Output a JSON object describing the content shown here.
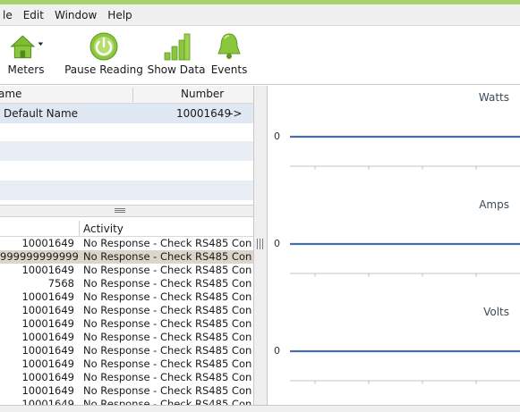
{
  "menu": {
    "items": [
      "le",
      "Edit",
      "Window",
      "Help"
    ]
  },
  "toolbar": {
    "meters_label": "Meters",
    "pause_label": "Pause Reading",
    "show_data_label": "Show Data",
    "events_label": "Events"
  },
  "meters_table": {
    "headers": {
      "name": "ame",
      "number": "Number"
    },
    "rows": [
      {
        "name": "Default Name",
        "number": "10001649",
        "arrow": "->"
      }
    ]
  },
  "activity_table": {
    "headers": {
      "activity": "Activity"
    },
    "rows": [
      {
        "id": "10001649",
        "activity": "No Response - Check RS485 Conn..."
      },
      {
        "id": "999999999999",
        "activity": "No Response - Check RS485 Conn..."
      },
      {
        "id": "10001649",
        "activity": "No Response - Check RS485 Conn..."
      },
      {
        "id": "7568",
        "activity": "No Response - Check RS485 Conn..."
      },
      {
        "id": "10001649",
        "activity": "No Response - Check RS485 Conn..."
      },
      {
        "id": "10001649",
        "activity": "No Response - Check RS485 Conn..."
      },
      {
        "id": "10001649",
        "activity": "No Response - Check RS485 Conn..."
      },
      {
        "id": "10001649",
        "activity": "No Response - Check RS485 Conn..."
      },
      {
        "id": "10001649",
        "activity": "No Response - Check RS485 Conn..."
      },
      {
        "id": "10001649",
        "activity": "No Response - Check RS485 Conn..."
      },
      {
        "id": "10001649",
        "activity": "No Response - Check RS485 Conn..."
      },
      {
        "id": "10001649",
        "activity": "No Response - Check RS485 Conn..."
      },
      {
        "id": "10001649",
        "activity": "No Response - Check RS485 Conn..."
      }
    ]
  },
  "charts": [
    {
      "title": "Watts",
      "y_value_label": "0"
    },
    {
      "title": "Amps",
      "y_value_label": "0"
    },
    {
      "title": "Volts",
      "y_value_label": "0"
    }
  ],
  "colors": {
    "titlebar": "#a8d26a",
    "series_line": "#4a6fa5",
    "icon_green": "#8cc63f",
    "selected_row": "#dcd5c9"
  },
  "icons": [
    "home-icon",
    "dropdown-arrow-icon",
    "power-icon",
    "bar-chart-icon",
    "bell-icon",
    "vertical-grip-icon",
    "horizontal-grip-icon"
  ]
}
